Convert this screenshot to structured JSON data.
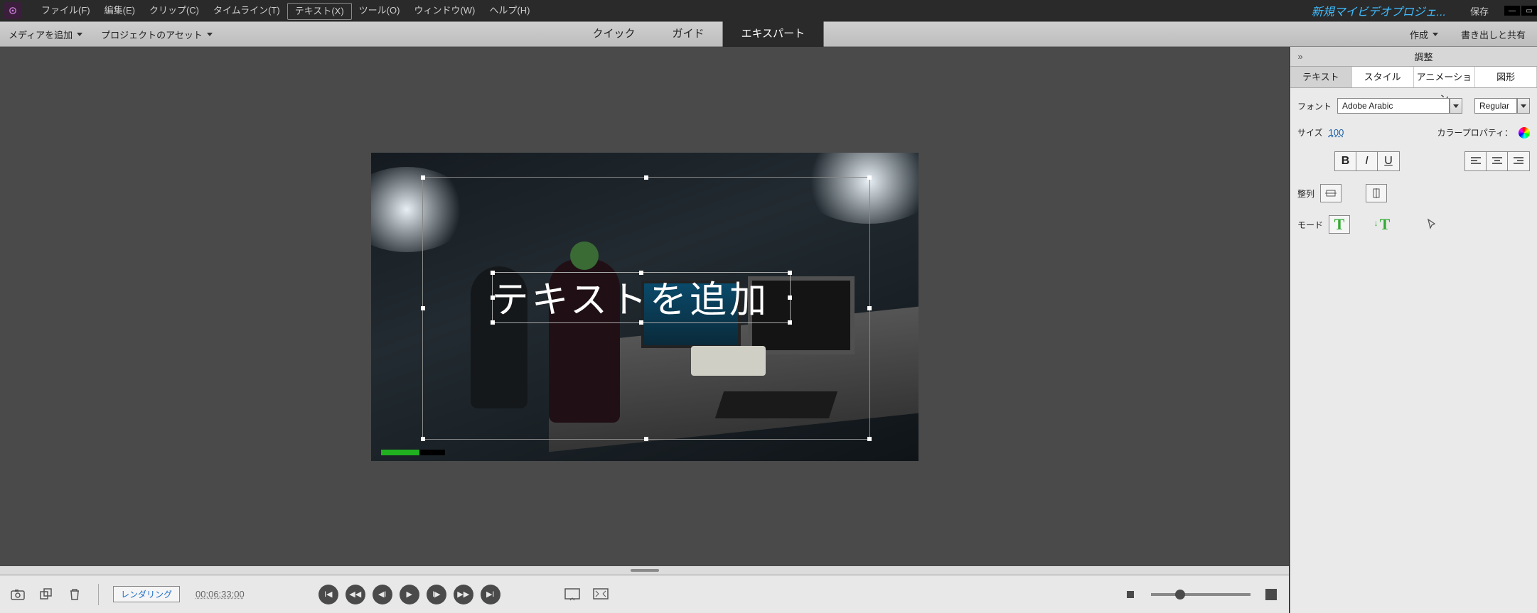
{
  "menu": {
    "items": [
      "ファイル(F)",
      "編集(E)",
      "クリップ(C)",
      "タイムライン(T)",
      "テキスト(X)",
      "ツール(O)",
      "ウィンドウ(W)",
      "ヘルプ(H)"
    ],
    "active_index": 4
  },
  "titlebar": {
    "project_name": "新規マイビデオプロジェ...",
    "save": "保存"
  },
  "secondary": {
    "add_media": "メディアを追加",
    "project_assets": "プロジェクトのアセット",
    "modes": [
      "クイック",
      "ガイド",
      "エキスパート"
    ],
    "active_mode_index": 2,
    "create": "作成",
    "export": "書き出しと共有"
  },
  "stage": {
    "overlay_text": "テキストを追加"
  },
  "controls": {
    "render": "レンダリング",
    "timecode": "00;06;33;00"
  },
  "right_panel": {
    "title": "調整",
    "tabs": [
      "テキスト",
      "スタイル",
      "アニメーション",
      "図形"
    ],
    "active_tab_index": 0,
    "font_label": "フォント",
    "font_value": "Adobe Arabic",
    "weight_value": "Regular",
    "size_label": "サイズ",
    "size_value": "100",
    "color_label": "カラープロパティ：",
    "align_label": "整列",
    "mode_label": "モード",
    "bold": "B",
    "italic": "I",
    "underline": "U"
  }
}
